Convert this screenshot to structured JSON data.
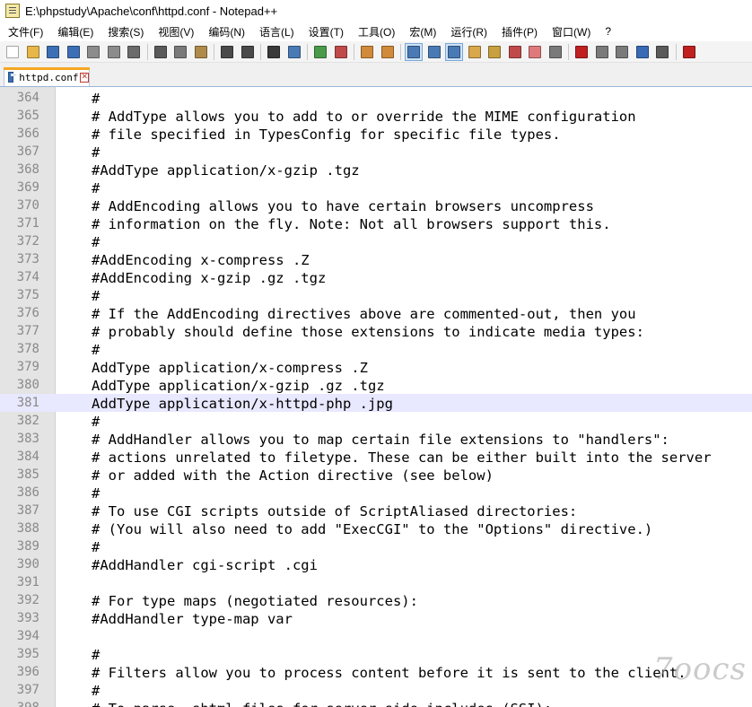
{
  "window": {
    "title": "E:\\phpstudy\\Apache\\conf\\httpd.conf - Notepad++"
  },
  "menu": [
    {
      "label": "文件(F)"
    },
    {
      "label": "编辑(E)"
    },
    {
      "label": "搜索(S)"
    },
    {
      "label": "视图(V)"
    },
    {
      "label": "编码(N)"
    },
    {
      "label": "语言(L)"
    },
    {
      "label": "设置(T)"
    },
    {
      "label": "工具(O)"
    },
    {
      "label": "宏(M)"
    },
    {
      "label": "运行(R)"
    },
    {
      "label": "插件(P)"
    },
    {
      "label": "窗口(W)"
    },
    {
      "label": "?"
    }
  ],
  "toolbar": [
    {
      "icon": "new-file-icon",
      "color": "#ffffff"
    },
    {
      "icon": "open-file-icon",
      "color": "#e8b74a"
    },
    {
      "icon": "save-icon",
      "color": "#3d6fb5"
    },
    {
      "icon": "save-all-icon",
      "color": "#3d6fb5"
    },
    {
      "icon": "close-icon",
      "color": "#8c8c8c"
    },
    {
      "icon": "close-all-icon",
      "color": "#8c8c8c"
    },
    {
      "icon": "print-icon",
      "color": "#6b6b6b"
    },
    {
      "sep": true
    },
    {
      "icon": "cut-icon",
      "color": "#5a5a5a"
    },
    {
      "icon": "copy-icon",
      "color": "#7a7a7a"
    },
    {
      "icon": "paste-icon",
      "color": "#b08a4a"
    },
    {
      "sep": true
    },
    {
      "icon": "undo-icon",
      "color": "#4a4a4a"
    },
    {
      "icon": "redo-icon",
      "color": "#4a4a4a"
    },
    {
      "sep": true
    },
    {
      "icon": "find-icon",
      "color": "#3a3a3a"
    },
    {
      "icon": "replace-icon",
      "color": "#4a7ab5"
    },
    {
      "sep": true
    },
    {
      "icon": "zoom-in-icon",
      "color": "#4a9a4a"
    },
    {
      "icon": "zoom-out-icon",
      "color": "#c04a4a"
    },
    {
      "sep": true
    },
    {
      "icon": "sync-vertical-icon",
      "color": "#d08a3a"
    },
    {
      "icon": "sync-horizontal-icon",
      "color": "#d08a3a"
    },
    {
      "sep": true
    },
    {
      "icon": "word-wrap-icon",
      "color": "#4a7ab5",
      "active": true
    },
    {
      "icon": "show-all-chars-icon",
      "color": "#4a7ab5"
    },
    {
      "icon": "indent-guide-icon",
      "color": "#4a7ab5",
      "active": true
    },
    {
      "icon": "language-icon",
      "color": "#d8a84a"
    },
    {
      "icon": "doc-map-icon",
      "color": "#c8a040"
    },
    {
      "icon": "function-list-icon",
      "color": "#c04a4a"
    },
    {
      "icon": "folder-workspace-icon",
      "color": "#e07a7a"
    },
    {
      "icon": "monitoring-icon",
      "color": "#7a7a7a"
    },
    {
      "sep": true
    },
    {
      "icon": "record-macro-icon",
      "color": "#c02020"
    },
    {
      "icon": "stop-record-icon",
      "color": "#7a7a7a"
    },
    {
      "icon": "play-macro-icon",
      "color": "#7a7a7a"
    },
    {
      "icon": "run-macro-multiple-icon",
      "color": "#3a6ab5"
    },
    {
      "icon": "save-macro-icon",
      "color": "#5a5a5a"
    },
    {
      "sep": true
    },
    {
      "icon": "spell-check-icon",
      "color": "#c02020"
    }
  ],
  "tab": {
    "label": "httpd.conf",
    "close_glyph": "✕"
  },
  "editor": {
    "current_line": 381,
    "lines": [
      {
        "n": "364",
        "text": "#"
      },
      {
        "n": "365",
        "text": "# AddType allows you to add to or override the MIME configuration"
      },
      {
        "n": "366",
        "text": "# file specified in TypesConfig for specific file types."
      },
      {
        "n": "367",
        "text": "#"
      },
      {
        "n": "368",
        "text": "#AddType application/x-gzip .tgz"
      },
      {
        "n": "369",
        "text": "#"
      },
      {
        "n": "370",
        "text": "# AddEncoding allows you to have certain browsers uncompress"
      },
      {
        "n": "371",
        "text": "# information on the fly. Note: Not all browsers support this."
      },
      {
        "n": "372",
        "text": "#"
      },
      {
        "n": "373",
        "text": "#AddEncoding x-compress .Z"
      },
      {
        "n": "374",
        "text": "#AddEncoding x-gzip .gz .tgz"
      },
      {
        "n": "375",
        "text": "#"
      },
      {
        "n": "376",
        "text": "# If the AddEncoding directives above are commented-out, then you"
      },
      {
        "n": "377",
        "text": "# probably should define those extensions to indicate media types:"
      },
      {
        "n": "378",
        "text": "#"
      },
      {
        "n": "379",
        "text": "AddType application/x-compress .Z"
      },
      {
        "n": "380",
        "text": "AddType application/x-gzip .gz .tgz"
      },
      {
        "n": "381",
        "text": "AddType application/x-httpd-php .jpg"
      },
      {
        "n": "382",
        "text": "#"
      },
      {
        "n": "383",
        "text": "# AddHandler allows you to map certain file extensions to \"handlers\":"
      },
      {
        "n": "384",
        "text": "# actions unrelated to filetype. These can be either built into the server"
      },
      {
        "n": "385",
        "text": "# or added with the Action directive (see below)"
      },
      {
        "n": "386",
        "text": "#"
      },
      {
        "n": "387",
        "text": "# To use CGI scripts outside of ScriptAliased directories:"
      },
      {
        "n": "388",
        "text": "# (You will also need to add \"ExecCGI\" to the \"Options\" directive.)"
      },
      {
        "n": "389",
        "text": "#"
      },
      {
        "n": "390",
        "text": "#AddHandler cgi-script .cgi"
      },
      {
        "n": "391",
        "text": ""
      },
      {
        "n": "392",
        "text": "# For type maps (negotiated resources):"
      },
      {
        "n": "393",
        "text": "#AddHandler type-map var"
      },
      {
        "n": "394",
        "text": ""
      },
      {
        "n": "395",
        "text": "#"
      },
      {
        "n": "396",
        "text": "# Filters allow you to process content before it is sent to the client."
      },
      {
        "n": "397",
        "text": "#"
      },
      {
        "n": "398",
        "text": "# To parse .shtml files for server-side includes (SSI):"
      }
    ]
  },
  "watermark": {
    "text": "7oocs"
  }
}
